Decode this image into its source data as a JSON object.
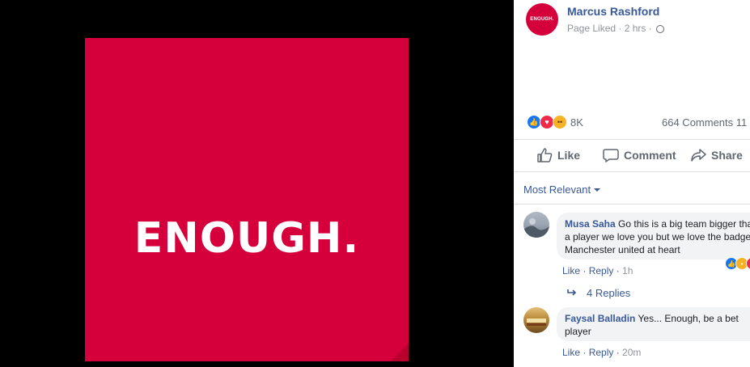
{
  "post": {
    "image_text": "ENOUGH.",
    "avatar_text": "ENOUGH.",
    "page_name": "Marcus Rashford",
    "meta_text": "Page Liked · 2 hrs ·",
    "reaction_count": "8K",
    "comments_shares": "664 Comments 11",
    "brand_color": "#d5003b"
  },
  "actions": {
    "like": "Like",
    "comment": "Comment",
    "share": "Share"
  },
  "sort": {
    "label": "Most Relevant"
  },
  "comments": [
    {
      "author": "Musa Saha",
      "text": "Go this is a big team bigger than a player we love you but we love the badge Manchester united at heart",
      "like": "Like",
      "reply": "Reply",
      "time": "1h"
    },
    {
      "author": "Faysal Balladin",
      "text": "Yes... Enough, be a bet player",
      "like": "Like",
      "reply": "Reply",
      "time": "20m"
    }
  ],
  "replies_label": "4 Replies"
}
